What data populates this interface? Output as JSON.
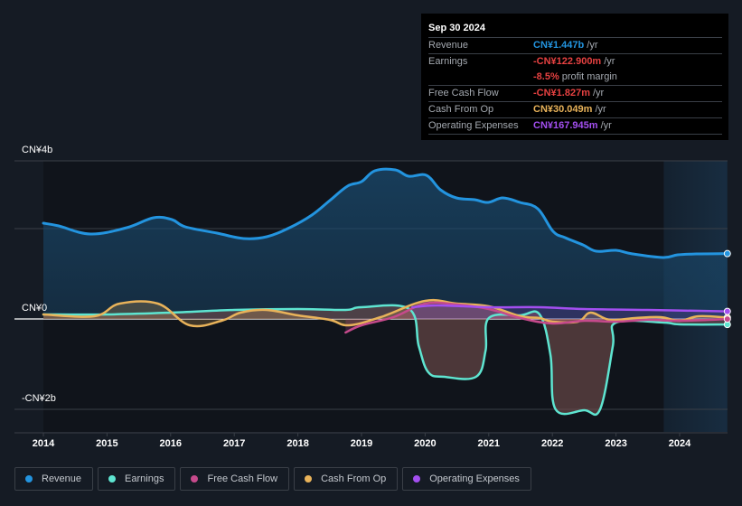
{
  "tooltip": {
    "date": "Sep 30 2024",
    "rows": [
      {
        "label": "Revenue",
        "value": "CN¥1.447b",
        "suffix": "/yr",
        "color": "#2394df"
      },
      {
        "label": "Earnings",
        "value": "-CN¥122.900m",
        "suffix": "/yr",
        "color": "#e64141"
      },
      {
        "label": "",
        "value": "-8.5%",
        "suffix": "profit margin",
        "color": "#e64141"
      },
      {
        "label": "Free Cash Flow",
        "value": "-CN¥1.827m",
        "suffix": "/yr",
        "color": "#e64141"
      },
      {
        "label": "Cash From Op",
        "value": "CN¥30.049m",
        "suffix": "/yr",
        "color": "#e9b35a"
      },
      {
        "label": "Operating Expenses",
        "value": "CN¥167.945m",
        "suffix": "/yr",
        "color": "#a34ff0"
      }
    ]
  },
  "legend": [
    {
      "label": "Revenue",
      "color": "#2394df"
    },
    {
      "label": "Earnings",
      "color": "#5ee5d1"
    },
    {
      "label": "Free Cash Flow",
      "color": "#c64a8c"
    },
    {
      "label": "Cash From Op",
      "color": "#e9b35a"
    },
    {
      "label": "Operating Expenses",
      "color": "#a34ff0"
    }
  ],
  "chart_data": {
    "type": "area",
    "title": "",
    "xlabel": "",
    "ylabel": "",
    "unit": "CN¥ billions",
    "xlim": [
      2013.67,
      2024.75
    ],
    "ylim": [
      -2.5,
      3.5
    ],
    "y_gridlines": [
      3.5,
      2,
      0,
      -2
    ],
    "y_tick_labels": [
      {
        "value": 3.5,
        "label": "CN¥4b"
      },
      {
        "value": 0,
        "label": "CN¥0"
      },
      {
        "value": -2,
        "label": "-CN¥2b"
      }
    ],
    "x_tick_labels": [
      "2014",
      "2015",
      "2016",
      "2017",
      "2018",
      "2019",
      "2020",
      "2021",
      "2022",
      "2023",
      "2024"
    ],
    "x_ticks": [
      2014,
      2015,
      2016,
      2017,
      2018,
      2019,
      2020,
      2021,
      2022,
      2023,
      2024
    ],
    "highlight_range": [
      2023.75,
      2024.75
    ],
    "legend_position": "bottom",
    "series": [
      {
        "name": "Revenue",
        "color": "#2394df",
        "x": [
          2014.0,
          2014.24,
          2014.74,
          2015.31,
          2015.73,
          2016.02,
          2016.23,
          2016.73,
          2017.15,
          2017.51,
          2017.87,
          2018.22,
          2018.5,
          2018.78,
          2019.0,
          2019.21,
          2019.53,
          2019.74,
          2020.02,
          2020.24,
          2020.49,
          2020.78,
          2020.99,
          2021.22,
          2021.49,
          2021.77,
          2022.01,
          2022.2,
          2022.48,
          2022.69,
          2023.0,
          2023.26,
          2023.74,
          2023.97,
          2024.26,
          2024.75
        ],
        "values": [
          2.12,
          2.06,
          1.88,
          2.02,
          2.24,
          2.2,
          2.04,
          1.9,
          1.78,
          1.82,
          2.02,
          2.3,
          2.62,
          2.94,
          3.04,
          3.28,
          3.3,
          3.16,
          3.18,
          2.86,
          2.68,
          2.64,
          2.58,
          2.68,
          2.58,
          2.44,
          1.94,
          1.8,
          1.64,
          1.5,
          1.52,
          1.44,
          1.36,
          1.42,
          1.44,
          1.447
        ]
      },
      {
        "name": "Earnings",
        "color": "#5ee5d1",
        "x": [
          2014.0,
          2015.0,
          2016.0,
          2017.0,
          2018.0,
          2018.75,
          2019.0,
          2019.75,
          2019.9,
          2020.05,
          2020.3,
          2020.8,
          2020.95,
          2021.0,
          2021.5,
          2021.8,
          2021.97,
          2022.05,
          2022.5,
          2022.75,
          2022.95,
          2023.0,
          2023.75,
          2024.0,
          2024.75
        ],
        "values": [
          0.1,
          0.1,
          0.14,
          0.2,
          0.22,
          0.2,
          0.26,
          0.22,
          -0.6,
          -1.18,
          -1.28,
          -1.28,
          -0.7,
          0.02,
          0.08,
          0.1,
          -0.8,
          -2.0,
          -2.02,
          -2.0,
          -0.6,
          -0.08,
          -0.08,
          -0.12,
          -0.123
        ]
      },
      {
        "name": "Free Cash Flow",
        "color": "#c64a8c",
        "x": [
          2018.75,
          2019.0,
          2019.5,
          2020.0,
          2020.5,
          2021.0,
          2021.5,
          2022.0,
          2022.5,
          2023.0,
          2023.5,
          2024.0,
          2024.75
        ],
        "values": [
          -0.3,
          -0.14,
          0.04,
          0.34,
          0.32,
          0.22,
          0.02,
          -0.1,
          -0.04,
          -0.06,
          -0.02,
          -0.04,
          -0.002
        ]
      },
      {
        "name": "Cash From Op",
        "color": "#e9b35a",
        "x": [
          2014.0,
          2014.8,
          2015.2,
          2015.8,
          2016.3,
          2016.8,
          2017.1,
          2017.5,
          2018.0,
          2018.5,
          2018.8,
          2019.3,
          2020.0,
          2020.5,
          2021.0,
          2021.5,
          2021.8,
          2022.0,
          2022.4,
          2022.6,
          2022.9,
          2023.3,
          2023.7,
          2024.0,
          2024.3,
          2024.75
        ],
        "values": [
          0.1,
          0.06,
          0.34,
          0.34,
          -0.14,
          -0.04,
          0.14,
          0.2,
          0.08,
          -0.02,
          -0.14,
          0.04,
          0.4,
          0.34,
          0.28,
          0.06,
          0.02,
          -0.06,
          -0.06,
          0.14,
          -0.02,
          0.02,
          0.04,
          -0.04,
          0.06,
          0.03
        ]
      },
      {
        "name": "Operating Expenses",
        "color": "#a34ff0",
        "x": [
          2019.8,
          2020.2,
          2021.0,
          2021.8,
          2022.5,
          2023.5,
          2024.75
        ],
        "values": [
          0.26,
          0.3,
          0.26,
          0.26,
          0.22,
          0.2,
          0.168
        ]
      }
    ]
  }
}
